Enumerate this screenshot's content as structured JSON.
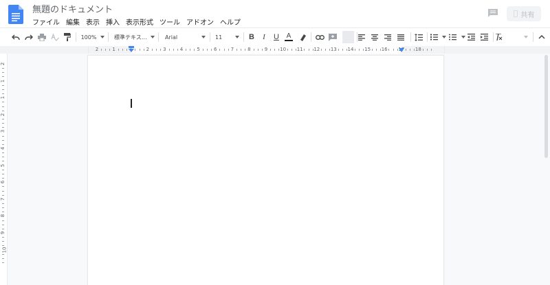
{
  "header": {
    "title": "無題のドキュメント",
    "menu": [
      "ファイル",
      "編集",
      "表示",
      "挿入",
      "表示形式",
      "ツール",
      "アドオン",
      "ヘルプ"
    ],
    "share_label": "共有"
  },
  "toolbar": {
    "zoom": "100%",
    "style": "標準テキス…",
    "font": "Arial",
    "size": "11"
  },
  "ruler": {
    "labels": [
      "2",
      "1",
      "1",
      "2",
      "3",
      "4",
      "5",
      "6",
      "7",
      "8",
      "9",
      "10",
      "11",
      "12",
      "13",
      "14",
      "15",
      "16",
      "17",
      "18"
    ]
  },
  "vruler": {
    "labels": [
      "2",
      "1",
      "1",
      "2",
      "3",
      "4",
      "5",
      "6",
      "7",
      "8",
      "9",
      "10"
    ]
  },
  "colors": {
    "accent": "#4285f4",
    "text": "#202124",
    "muted": "#5f6368",
    "canvas": "#f8f9fa"
  }
}
